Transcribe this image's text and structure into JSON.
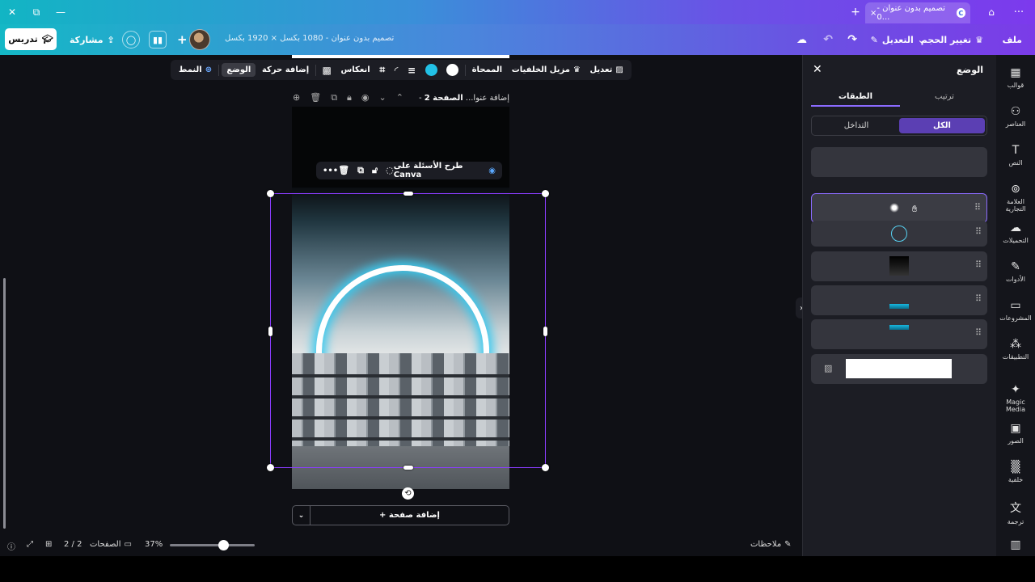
{
  "browser": {
    "tab_title": "تصميم بدون عنوان - 0...",
    "tab_close": "×",
    "new_tab": "+",
    "home_icon": "⌂",
    "more_icon": "···",
    "win_close": "✕",
    "win_restore": "⧉",
    "win_min": "—"
  },
  "header": {
    "file_label": "ملف",
    "resize_label": "تغيير الحجم",
    "edit_label": "التعديل",
    "doc_title": "تصميم بدون عنوان - 1080 بكسل × 1920 بكسل",
    "share_label": "مشاركة",
    "teach_label": "تدريس",
    "plus": "+"
  },
  "floatbar": {
    "edit": "تعديل",
    "bg_remover": "مزيل الخلفيات",
    "eraser": "الممحاة",
    "flip": "انعكاس",
    "animate": "إضافة حركة",
    "position": "الوضع",
    "style": "النمط",
    "colors": {
      "white": "#ffffff",
      "cyan": "#22c1e6"
    }
  },
  "pagebar": {
    "page_label": "الصفحة 2",
    "page_sub": " - إضافة عنوا..."
  },
  "ai_toolbar": {
    "label": "طرح الأسئلة على Canva",
    "more": "•••"
  },
  "canvas": {
    "add_page": "+ إضافة صفحة",
    "rotate": "⟲"
  },
  "statusbar": {
    "notes": "ملاحظات",
    "zoom": "37%",
    "pages_label": "الصفحات",
    "pages_count": "2 / 2",
    "zoom_fraction": 0.37
  },
  "panel": {
    "title": "الوضع",
    "tabs": [
      "ترتيب",
      "الطبقات"
    ],
    "subtabs": [
      "الكل",
      "التداخل"
    ]
  },
  "sidebar": {
    "items": [
      {
        "label": "قوالب",
        "icon": "▦"
      },
      {
        "label": "العناصر",
        "icon": "⚇"
      },
      {
        "label": "النص",
        "icon": "T"
      },
      {
        "label": "العلامة التجارية",
        "icon": "⊚"
      },
      {
        "label": "التحميلات",
        "icon": "☁"
      },
      {
        "label": "الأدوات",
        "icon": "✎"
      },
      {
        "label": "المشروعات",
        "icon": "▭"
      },
      {
        "label": "التطبيقات",
        "icon": "⁂"
      },
      {
        "label": "Magic Media",
        "icon": "✦"
      },
      {
        "label": "الصور",
        "icon": "▣"
      },
      {
        "label": "خلفية",
        "icon": "▒"
      },
      {
        "label": "ترجمة",
        "icon": "文"
      },
      {
        "label": "",
        "icon": "▥"
      }
    ]
  }
}
